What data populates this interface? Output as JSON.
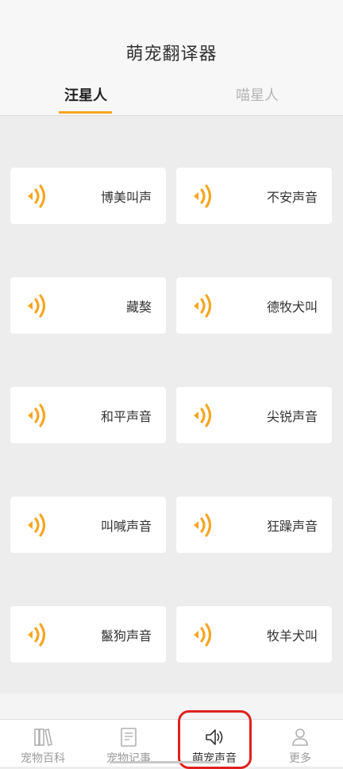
{
  "header": {
    "title": "萌宠翻译器",
    "tabs": [
      {
        "label": "汪星人",
        "active": true
      },
      {
        "label": "喵星人",
        "active": false
      }
    ]
  },
  "sounds": [
    {
      "label": "博美叫声",
      "icon": "sound-wave-icon"
    },
    {
      "label": "不安声音",
      "icon": "sound-wave-icon"
    },
    {
      "label": "藏獒",
      "icon": "sound-wave-icon"
    },
    {
      "label": "德牧犬叫",
      "icon": "sound-wave-icon"
    },
    {
      "label": "和平声音",
      "icon": "sound-wave-icon"
    },
    {
      "label": "尖锐声音",
      "icon": "sound-wave-icon"
    },
    {
      "label": "叫喊声音",
      "icon": "sound-wave-icon"
    },
    {
      "label": "狂躁声音",
      "icon": "sound-wave-icon"
    },
    {
      "label": "鬣狗声音",
      "icon": "sound-wave-icon"
    },
    {
      "label": "牧羊犬叫",
      "icon": "sound-wave-icon"
    }
  ],
  "tabbar": {
    "items": [
      {
        "label": "宠物百科",
        "icon": "books-icon",
        "active": false
      },
      {
        "label": "宠物记事",
        "icon": "notepad-icon",
        "active": false
      },
      {
        "label": "萌宠声音",
        "icon": "speaker-icon",
        "active": true
      },
      {
        "label": "更多",
        "icon": "person-icon",
        "active": false
      }
    ]
  },
  "colors": {
    "accent": "#f5a623",
    "highlight": "#e02020",
    "background": "#ededed"
  }
}
